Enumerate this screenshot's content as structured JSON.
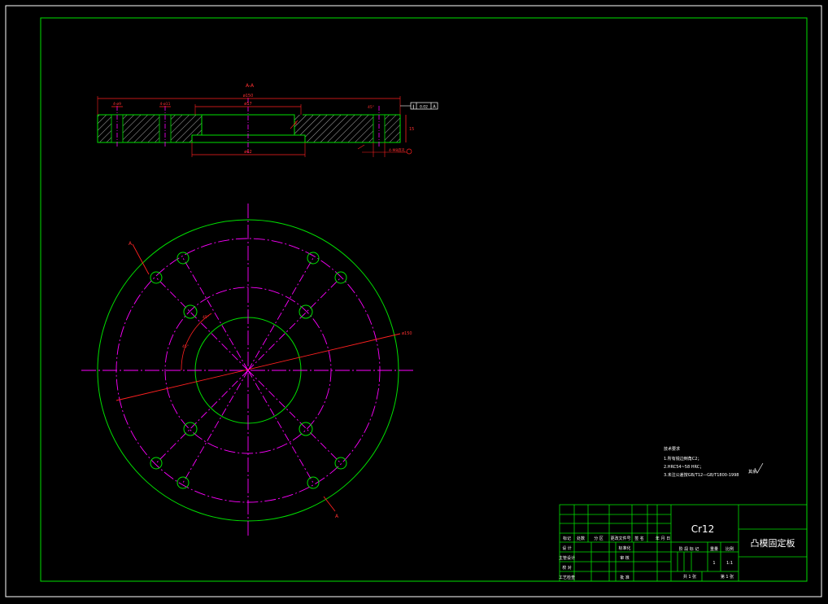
{
  "colors": {
    "background": "#000000",
    "frame": "#ffffff",
    "outline": "#00e000",
    "centerline": "#ff00ff",
    "dimension": "#ff2020",
    "text": "#ffffff",
    "hatch": "#ffffff"
  },
  "section_view": {
    "title": "A-A",
    "dims": {
      "overall_width": "ø150",
      "bore_top": "ø57",
      "bore_bottom": "ø62",
      "left_a": "4-ø9",
      "left_b": "4-ø11",
      "thickness": "15",
      "step": "3",
      "bottom_right": "4-M8底孔",
      "angle": "45°"
    },
    "tolerance_box": [
      "∥",
      "0.02",
      "A"
    ],
    "datum": "A"
  },
  "plan_view": {
    "section_mark_top": "A",
    "section_mark_bottom": "A",
    "leader_label": "ø150",
    "angle_label_1": "45°",
    "angle_label_2": "45°"
  },
  "notes": {
    "heading": "技术要求",
    "lines": [
      "1.所有锐边倒角C2；",
      "2.HRC54~58 HRC；",
      "3.未注公差按GB/T12—GB/T1800-1998"
    ],
    "roughness": "其余"
  },
  "title_block": {
    "material": "Cr12",
    "part_name": "凸模固定板",
    "header_row": [
      "标记",
      "处数",
      "分 区",
      "更改文件号",
      "签 名",
      "年 月 日"
    ],
    "left_rows": [
      [
        "设 计",
        "",
        "标准化"
      ],
      [
        "主管设计",
        "",
        "审 核"
      ],
      [
        "校 对",
        "",
        ""
      ],
      [
        "工艺检查",
        "",
        "批 准"
      ]
    ],
    "stage_label": "阶 段 标 记",
    "weight_label": "重量",
    "scale_label": "比例",
    "quantity": "1",
    "scale": "1:1",
    "sheets_total": "共 1 张",
    "sheet_no": "第 1 张"
  }
}
